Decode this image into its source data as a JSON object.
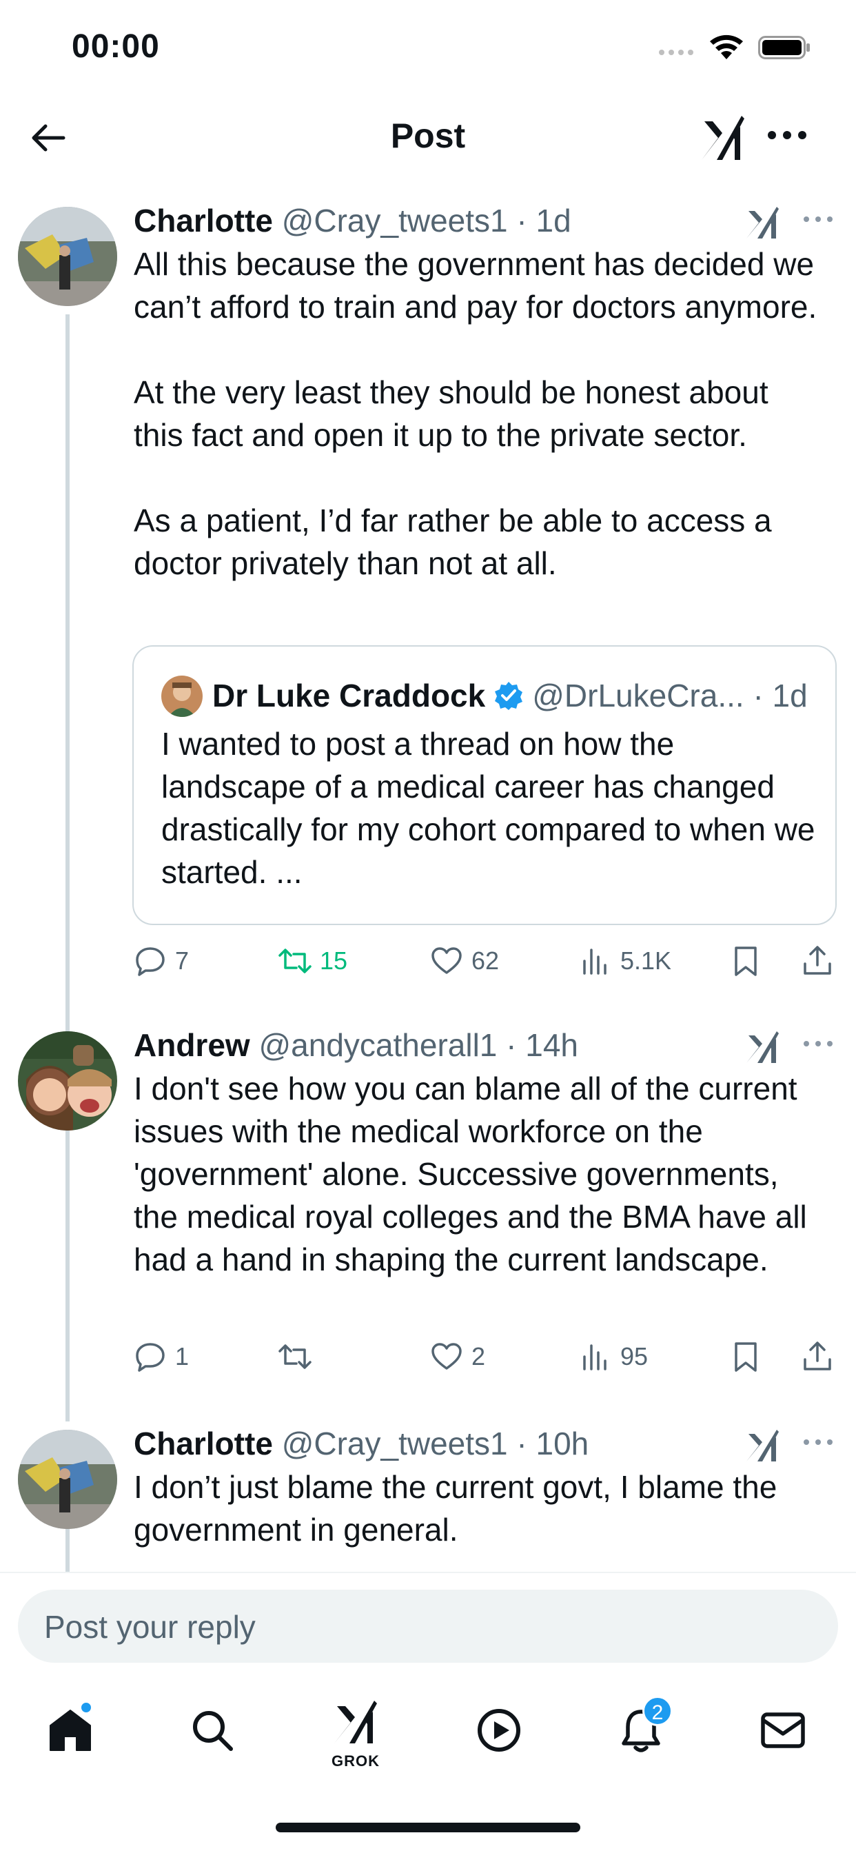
{
  "status_bar": {
    "time": "00:00"
  },
  "header": {
    "title": "Post"
  },
  "posts": [
    {
      "name": "Charlotte",
      "handle_time": "@Cray_tweets1 · 1d",
      "text": "All this because the government has decided we can’t afford to train and pay for doctors anymore.\n\nAt the very least they should be honest about this fact and open it up to the private sector.\n\nAs a patient, I’d far rather be able to access a doctor privately than not at all.",
      "quote": {
        "name": "Dr Luke Craddock",
        "handle_time": "@DrLukeCra... · 1d",
        "text": "I wanted to post a thread on how the landscape of a medical career has changed drastically for my cohort compared to when we started. ..."
      },
      "stats": {
        "replies": "7",
        "reposts": "15",
        "likes": "62",
        "views": "5.1K"
      }
    },
    {
      "name": "Andrew",
      "handle_time": "@andycatherall1 · 14h",
      "text": "I don't see how you can blame all of the current issues with the medical workforce on the 'government' alone. Successive governments, the medical royal colleges and the BMA have all had a hand in shaping the current landscape.",
      "stats": {
        "replies": "1",
        "reposts": "",
        "likes": "2",
        "views": "95"
      }
    },
    {
      "name": "Charlotte",
      "handle_time": "@Cray_tweets1 · 10h",
      "text": "I don’t just blame the current govt, I blame the government in general."
    }
  ],
  "reply": {
    "placeholder": "Post your reply"
  },
  "nav": {
    "grok_label": "GROK",
    "notifications_badge": "2"
  },
  "colors": {
    "accent": "#1d9bf0",
    "repost_active": "#00ba7c",
    "secondary_text": "#536471",
    "border": "#cfd9de"
  }
}
